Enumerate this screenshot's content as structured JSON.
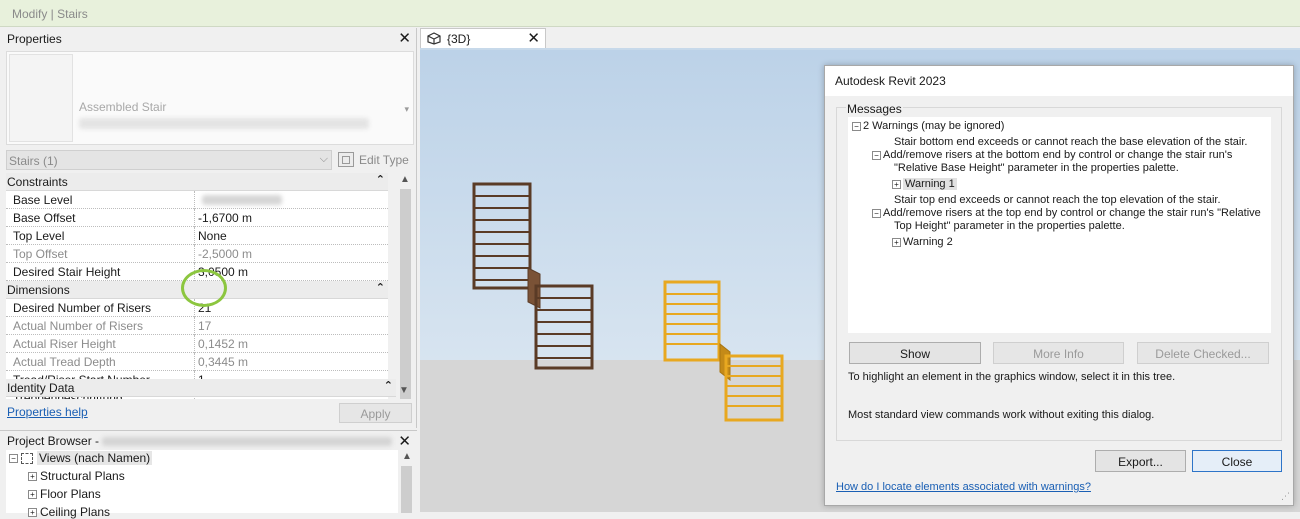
{
  "ribbon": {
    "title": "Modify | Stairs"
  },
  "properties": {
    "title": "Properties",
    "close": "✕",
    "type_name": "Assembled Stair",
    "type_arrow": "▾",
    "selector": "Stairs (1)",
    "selector_arrow": "⌵",
    "edit_type": "Edit Type",
    "groups": {
      "constraints": "Constraints",
      "dimensions": "Dimensions",
      "identity": "Identity Data"
    },
    "collapse": "⌃",
    "rows": {
      "base_level": {
        "label": "Base Level",
        "value": ""
      },
      "base_offset": {
        "label": "Base Offset",
        "value": "-1,6700 m"
      },
      "top_level": {
        "label": "Top Level",
        "value": "None"
      },
      "top_offset": {
        "label": "Top Offset",
        "value": "-2,5000 m"
      },
      "desired_height": {
        "label": "Desired Stair Height",
        "value": "3,0500 m"
      },
      "desired_risers": {
        "label": "Desired Number of Risers",
        "value": "21"
      },
      "actual_risers": {
        "label": "Actual Number of Risers",
        "value": "17"
      },
      "actual_riser_height": {
        "label": "Actual Riser Height",
        "value": "0,1452 m"
      },
      "actual_tread_depth": {
        "label": "Actual Tread Depth",
        "value": "0,3445 m"
      },
      "start_number": {
        "label": "Tread/Riser Start Number",
        "value": "1"
      },
      "labeling": {
        "label": "Treppenbeschriftung",
        "value": ""
      }
    },
    "help_link": "Properties help",
    "apply": "Apply"
  },
  "project_browser": {
    "title": "Project Browser -",
    "close": "✕",
    "items": {
      "views": "Views (nach Namen)",
      "structural": "Structural Plans",
      "floor": "Floor Plans",
      "ceiling": "Ceiling Plans"
    }
  },
  "view_tab": {
    "label": "{3D}",
    "close": "✕",
    "icon": "3d-view-icon"
  },
  "dialog": {
    "title": "Autodesk Revit 2023",
    "messages_legend": "Messages",
    "tree": {
      "root": "2 Warnings (may be ignored)",
      "w1_line1": "Stair bottom end exceeds or cannot reach the base elevation of the stair.",
      "w1_line2": "Add/remove risers at the bottom end by control or change the stair run's",
      "w1_line3": "\"Relative Base Height\" parameter in the properties palette.",
      "w1_node": "Warning 1",
      "w2_line1": "Stair top end exceeds or cannot reach the top elevation of the stair.",
      "w2_line2": "Add/remove risers at the top end by control or change the stair run's \"Relative",
      "w2_line3": "Top Height\" parameter in the properties palette.",
      "w2_node": "Warning 2"
    },
    "buttons": {
      "show": "Show",
      "more_info": "More Info",
      "delete_checked": "Delete Checked...",
      "export": "Export...",
      "close": "Close"
    },
    "note1": "To highlight an element in the graphics window, select it in this tree.",
    "note2": "Most standard view commands work without exiting this dialog.",
    "help_link": "How do I locate elements associated with warnings?"
  },
  "colors": {
    "ribbon_bg": "#e8f1dc",
    "stair_dark": "#5a3b26",
    "stair_yellow": "#e8a820",
    "highlight_ring": "#8cc63f",
    "link": "#1a5fb4"
  }
}
